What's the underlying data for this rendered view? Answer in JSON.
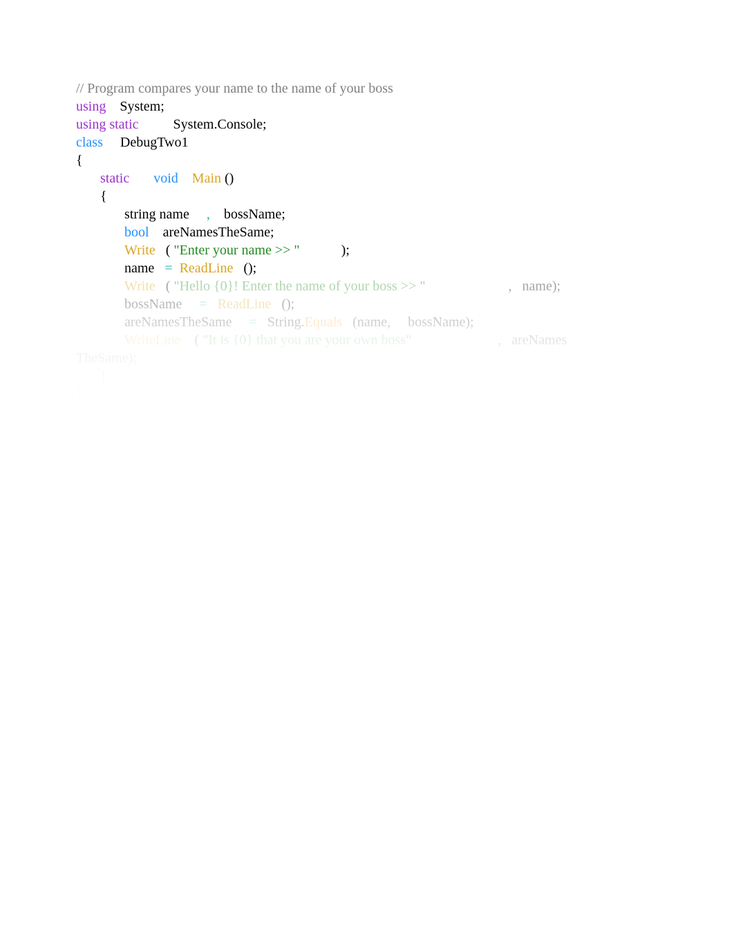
{
  "lines": {
    "l1_comment": "// Program compares your name to the name of your boss",
    "l2_using": "using",
    "l2_system": "    System;",
    "l3_using_static": "using static",
    "l3_console": "          System.Console;",
    "l4_class": "class",
    "l4_name": "     DebugTwo1",
    "l5_brace": "{",
    "l6_static": "static",
    "l6_void": "void",
    "l6_main": "Main",
    "l6_parens": " ()",
    "l7_brace": "{",
    "l8_string": "string name     ",
    "l8_comma": ",",
    "l8_boss": "    bossName;",
    "l9_bool": "bool",
    "l9_are": "    areNamesTheSame;",
    "l10_write": "Write",
    "l10_open": "   ( ",
    "l10_str": "\"Enter your name >> \"",
    "l10_close": "            );",
    "l11_name": "name   ",
    "l11_eq": "=",
    "l11_readline": "  ReadLine",
    "l11_parens": "   ();",
    "l12_write": "Write",
    "l12_open": "   ( ",
    "l12_str": "\"Hello {0}! Enter the name of your boss >> \"",
    "l12_comma": "                        ,",
    "l12_name": "   name);",
    "l13_boss": "bossName     ",
    "l13_eq": "=",
    "l13_readline": "   ReadLine",
    "l13_parens": "   ();",
    "l14_are": "areNamesTheSame     ",
    "l14_eq": "=",
    "l14_string": "   String.",
    "l14_equals": "Equals",
    "l14_args": "   (name,     bossName);",
    "l15_writeline": "WriteLine",
    "l15_open": "    ( ",
    "l15_str": "\"It is {0} that you are your own boss\"",
    "l15_comma": "                         ,",
    "l15_are": "   areNames",
    "l16_thesame": "TheSame);",
    "l17_brace": "}",
    "l18_brace": "}"
  }
}
